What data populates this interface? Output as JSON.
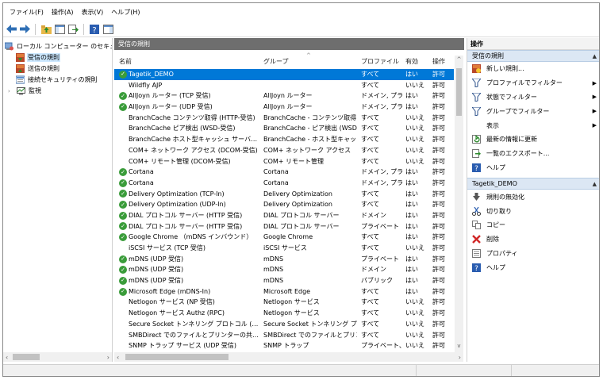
{
  "menu": [
    "ファイル(F)",
    "操作(A)",
    "表示(V)",
    "ヘルプ(H)"
  ],
  "toolbar_icons": [
    "back-arrow-icon",
    "forward-arrow-icon",
    "up-folder-icon",
    "show-hide-console-tree-icon",
    "export-list-icon",
    "help-icon",
    "show-hide-action-pane-icon"
  ],
  "tree": {
    "root": "ローカル コンピューター のセキュリティ",
    "items": [
      "受信の規則",
      "送信の規則",
      "接続セキュリティの規則",
      "監視"
    ]
  },
  "center": {
    "title": "受信の規則",
    "columns": {
      "name": "名前",
      "group": "グループ",
      "profile": "プロファイル",
      "enabled": "有効",
      "action": "操作"
    },
    "rows": [
      {
        "name": "Tagetik_DEMO",
        "group": "",
        "profile": "すべて",
        "enabled": "はい",
        "action": "許可",
        "on": true
      },
      {
        "name": "Wildfly AJP",
        "group": "",
        "profile": "すべて",
        "enabled": "いいえ",
        "action": "許可",
        "on": false
      },
      {
        "name": "AllJoyn ルーター (TCP 受信)",
        "group": "AllJoyn ルーター",
        "profile": "ドメイン, プラ...",
        "enabled": "はい",
        "action": "許可",
        "on": true
      },
      {
        "name": "AllJoyn ルーター (UDP 受信)",
        "group": "AllJoyn ルーター",
        "profile": "ドメイン, プラ...",
        "enabled": "はい",
        "action": "許可",
        "on": true
      },
      {
        "name": "BranchCache コンテンツ取得 (HTTP-受信)",
        "group": "BranchCache - コンテンツ取得...",
        "profile": "すべて",
        "enabled": "いいえ",
        "action": "許可",
        "on": false
      },
      {
        "name": "BranchCache ピア検出 (WSD-受信)",
        "group": "BranchCache - ピア検出 (WSD...",
        "profile": "すべて",
        "enabled": "いいえ",
        "action": "許可",
        "on": false
      },
      {
        "name": "BranchCache ホスト型キャッシュ サーバー (HTT...",
        "group": "BranchCache - ホスト型キャッシ...",
        "profile": "すべて",
        "enabled": "いいえ",
        "action": "許可",
        "on": false
      },
      {
        "name": "COM+ ネットワーク アクセス (DCOM-受信)",
        "group": "COM+ ネットワーク アクセス",
        "profile": "すべて",
        "enabled": "いいえ",
        "action": "許可",
        "on": false
      },
      {
        "name": "COM+ リモート管理 (DCOM-受信)",
        "group": "COM+ リモート管理",
        "profile": "すべて",
        "enabled": "いいえ",
        "action": "許可",
        "on": false
      },
      {
        "name": "Cortana",
        "group": "Cortana",
        "profile": "ドメイン, プラ...",
        "enabled": "はい",
        "action": "許可",
        "on": true
      },
      {
        "name": "Cortana",
        "group": "Cortana",
        "profile": "ドメイン, プラ...",
        "enabled": "はい",
        "action": "許可",
        "on": true
      },
      {
        "name": "Delivery Optimization (TCP-In)",
        "group": "Delivery Optimization",
        "profile": "すべて",
        "enabled": "はい",
        "action": "許可",
        "on": true
      },
      {
        "name": "Delivery Optimization (UDP-In)",
        "group": "Delivery Optimization",
        "profile": "すべて",
        "enabled": "はい",
        "action": "許可",
        "on": true
      },
      {
        "name": "DIAL プロトコル サーバー (HTTP 受信)",
        "group": "DIAL プロトコル サーバー",
        "profile": "ドメイン",
        "enabled": "はい",
        "action": "許可",
        "on": true
      },
      {
        "name": "DIAL プロトコル サーバー (HTTP 受信)",
        "group": "DIAL プロトコル サーバー",
        "profile": "プライベート",
        "enabled": "はい",
        "action": "許可",
        "on": true
      },
      {
        "name": "Google Chrome （mDNS インバウンド）",
        "group": "Google Chrome",
        "profile": "すべて",
        "enabled": "はい",
        "action": "許可",
        "on": true
      },
      {
        "name": "iSCSI サービス (TCP 受信)",
        "group": "iSCSI サービス",
        "profile": "すべて",
        "enabled": "いいえ",
        "action": "許可",
        "on": false
      },
      {
        "name": "mDNS (UDP 受信)",
        "group": "mDNS",
        "profile": "プライベート",
        "enabled": "はい",
        "action": "許可",
        "on": true
      },
      {
        "name": "mDNS (UDP 受信)",
        "group": "mDNS",
        "profile": "ドメイン",
        "enabled": "はい",
        "action": "許可",
        "on": true
      },
      {
        "name": "mDNS (UDP 受信)",
        "group": "mDNS",
        "profile": "パブリック",
        "enabled": "はい",
        "action": "許可",
        "on": true
      },
      {
        "name": "Microsoft Edge (mDNS-In)",
        "group": "Microsoft Edge",
        "profile": "すべて",
        "enabled": "はい",
        "action": "許可",
        "on": true
      },
      {
        "name": "Netlogon サービス (NP 受信)",
        "group": "Netlogon サービス",
        "profile": "すべて",
        "enabled": "いいえ",
        "action": "許可",
        "on": false
      },
      {
        "name": "Netlogon サービス Authz (RPC)",
        "group": "Netlogon サービス",
        "profile": "すべて",
        "enabled": "いいえ",
        "action": "許可",
        "on": false
      },
      {
        "name": "Secure Socket トンネリング プロトコル (SSTP 受...",
        "group": "Secure Socket トンネリング プロ...",
        "profile": "すべて",
        "enabled": "いいえ",
        "action": "許可",
        "on": false
      },
      {
        "name": "SMBDirect でのファイルとプリンターの共有 (iW...",
        "group": "SMBDirect でのファイルとプリン...",
        "profile": "すべて",
        "enabled": "いいえ",
        "action": "許可",
        "on": false
      },
      {
        "name": "SNMP トラップ サービス (UDP 受信)",
        "group": "SNMP トラップ",
        "profile": "プライベート、...",
        "enabled": "いいえ",
        "action": "許可",
        "on": false
      }
    ]
  },
  "actions": {
    "title": "操作",
    "section1": {
      "title": "受信の規則",
      "items": [
        {
          "label": "新しい規則...",
          "icon": "new-rule-icon",
          "sub": false
        },
        {
          "label": "プロファイルでフィルター",
          "icon": "filter-icon",
          "sub": true
        },
        {
          "label": "状態でフィルター",
          "icon": "filter-icon",
          "sub": true
        },
        {
          "label": "グループでフィルター",
          "icon": "filter-icon",
          "sub": true
        },
        {
          "label": "表示",
          "icon": "",
          "sub": true
        },
        {
          "label": "最新の情報に更新",
          "icon": "refresh-icon",
          "sub": false
        },
        {
          "label": "一覧のエクスポート...",
          "icon": "export-icon",
          "sub": false
        },
        {
          "label": "ヘルプ",
          "icon": "help-icon",
          "sub": false
        }
      ]
    },
    "section2": {
      "title": "Tagetik_DEMO",
      "items": [
        {
          "label": "規則の無効化",
          "icon": "disable-rule-icon"
        },
        {
          "label": "切り取り",
          "icon": "cut-icon"
        },
        {
          "label": "コピー",
          "icon": "copy-icon"
        },
        {
          "label": "削除",
          "icon": "delete-icon"
        },
        {
          "label": "プロパティ",
          "icon": "properties-icon"
        },
        {
          "label": "ヘルプ",
          "icon": "help-icon"
        }
      ]
    }
  },
  "colors": {
    "selection": "#0078d7",
    "enabled_check": "#3a9c3a",
    "panel_header": "#6e6e6e",
    "section_bg": "#dce7f4"
  }
}
